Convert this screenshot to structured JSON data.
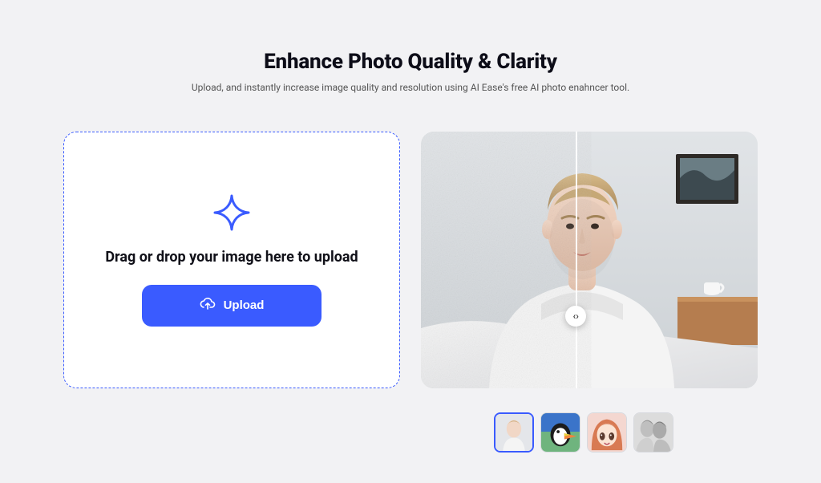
{
  "header": {
    "title": "Enhance Photo Quality & Clarity",
    "subtitle": "Upload, and instantly increase image quality and resolution using AI Ease's free AI photo enahncer tool."
  },
  "upload": {
    "drop_text": "Drag or drop your image here to upload",
    "button_label": "Upload"
  },
  "colors": {
    "accent": "#3A5BFF",
    "page_bg": "#f2f2f4",
    "card_bg": "#ffffff"
  },
  "compare": {
    "slider_position_pct": 46,
    "sample_alt": "Before/after portrait enhancement comparison"
  },
  "thumbnails": [
    {
      "name": "sample-portrait",
      "selected": true
    },
    {
      "name": "sample-puffin",
      "selected": false
    },
    {
      "name": "sample-anime",
      "selected": false
    },
    {
      "name": "sample-bw-photo",
      "selected": false
    }
  ]
}
